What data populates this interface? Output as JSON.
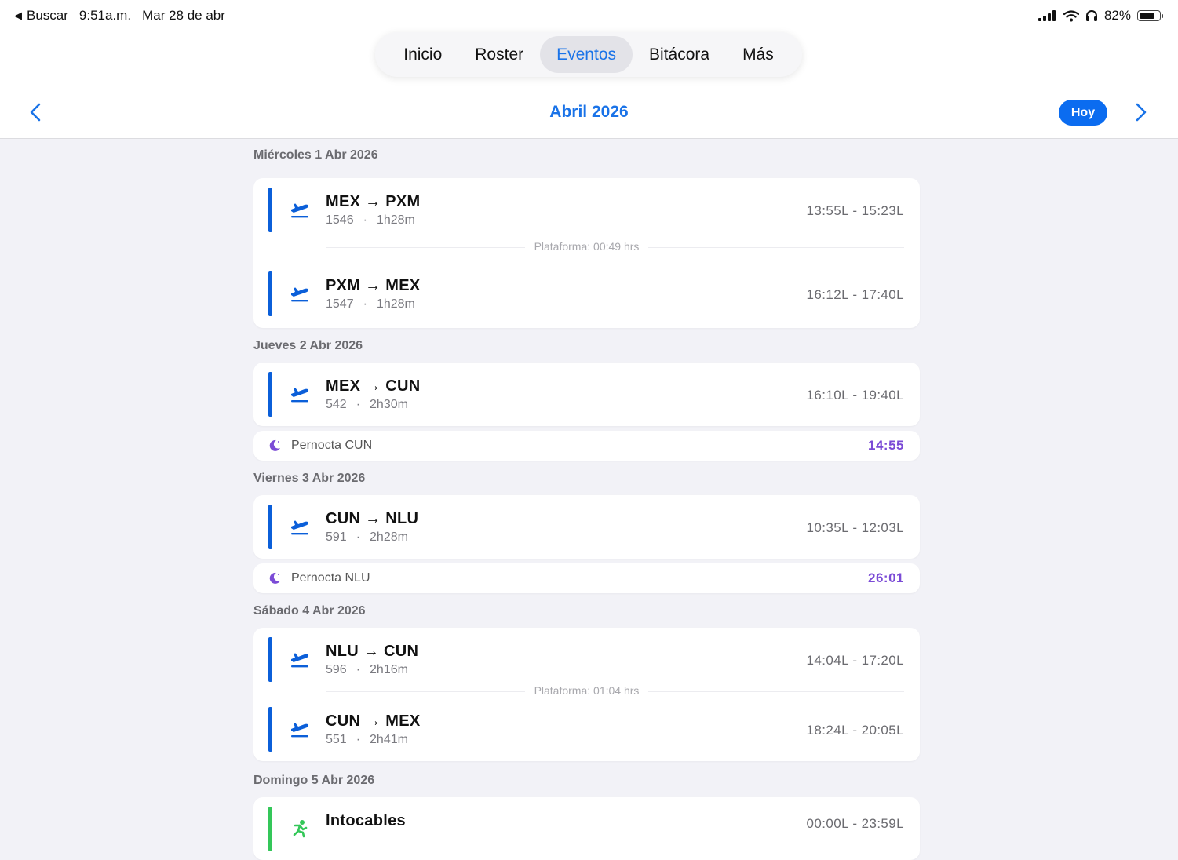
{
  "status_bar": {
    "back_label": "Buscar",
    "time": "9:51a.m.",
    "date": "Mar 28 de abr",
    "battery": "82%"
  },
  "tabs": [
    {
      "label": "Inicio",
      "active": false
    },
    {
      "label": "Roster",
      "active": false
    },
    {
      "label": "Eventos",
      "active": true
    },
    {
      "label": "Bitácora",
      "active": false
    },
    {
      "label": "Más",
      "active": false
    }
  ],
  "month_nav": {
    "title": "Abril 2026",
    "today_label": "Hoy"
  },
  "days": [
    {
      "header": "Miércoles 1 Abr 2026",
      "flights": [
        {
          "route": "MEX → PXM",
          "flight": "1546",
          "duration": "1h28m",
          "times": "13:55L - 15:23L"
        },
        {
          "route": "PXM → MEX",
          "flight": "1547",
          "duration": "1h28m",
          "times": "16:12L - 17:40L"
        }
      ],
      "platform": "Plataforma: 00:49 hrs"
    },
    {
      "header": "Jueves 2 Abr 2026",
      "flights": [
        {
          "route": "MEX → CUN",
          "flight": "542",
          "duration": "2h30m",
          "times": "16:10L - 19:40L"
        }
      ],
      "overnight": {
        "label": "Pernocta CUN",
        "value": "14:55"
      }
    },
    {
      "header": "Viernes 3 Abr 2026",
      "flights": [
        {
          "route": "CUN → NLU",
          "flight": "591",
          "duration": "2h28m",
          "times": "10:35L - 12:03L"
        }
      ],
      "overnight": {
        "label": "Pernocta NLU",
        "value": "26:01"
      }
    },
    {
      "header": "Sábado 4 Abr 2026",
      "flights": [
        {
          "route": "NLU → CUN",
          "flight": "596",
          "duration": "2h16m",
          "times": "14:04L - 17:20L"
        },
        {
          "route": "CUN → MEX",
          "flight": "551",
          "duration": "2h41m",
          "times": "18:24L - 20:05L"
        }
      ],
      "platform": "Plataforma: 01:04 hrs"
    },
    {
      "header": "Domingo 5 Abr 2026",
      "event": {
        "title": "Intocables",
        "times": "00:00L - 23:59L"
      }
    }
  ],
  "colors": {
    "accent": "#1a73e8",
    "flight_bar": "#0b5fd9",
    "off_bar": "#34c759",
    "overnight": "#7b4bd6"
  },
  "icons": {
    "flight": "plane-departure-icon",
    "overnight": "moon-icon",
    "off": "person-off-icon"
  }
}
